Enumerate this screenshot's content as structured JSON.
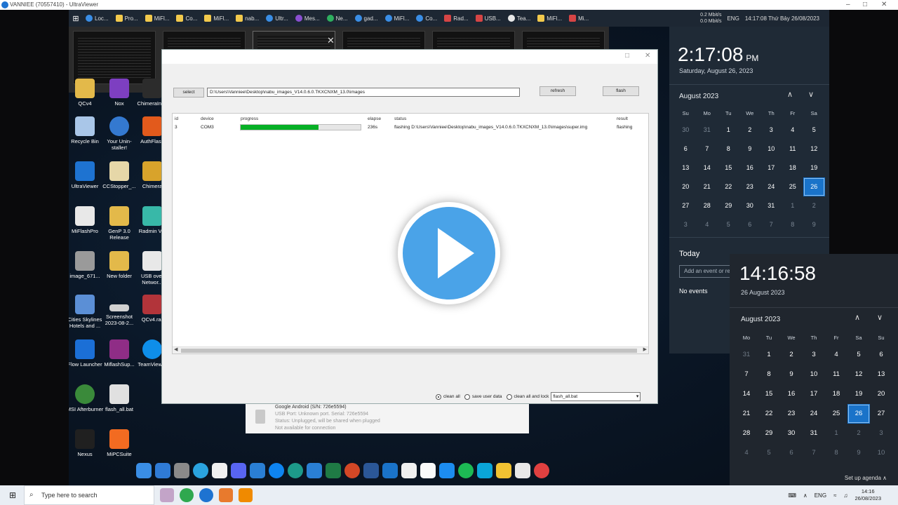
{
  "outer_window": {
    "title": "VANNIEE (70557410) - UltraViewer",
    "controls": [
      "–",
      "□",
      "✕"
    ]
  },
  "remote_taskbar": {
    "start_glyph": "⊞",
    "tabs": [
      "Loc...",
      "Pro...",
      "MiFl...",
      "Co...",
      "MiFl...",
      "nab...",
      "Ultr...",
      "Mes...",
      "Ne...",
      "gad...",
      "MiFl...",
      "Co...",
      "Rad...",
      "USB...",
      "Tea...",
      "MiFl...",
      "Mi..."
    ],
    "net_up": "0.2 Mbit/s",
    "net_down": "0.0 Mbit/s",
    "lang": "ENG",
    "datetime": "14:17:08 Thứ Bảy 26/08/2023"
  },
  "thumb_close": "✕",
  "desktop_icons": [
    {
      "label": "QCv4"
    },
    {
      "label": "Nox"
    },
    {
      "label": "ChimeraInt..."
    },
    {
      "label": "Recycle Bin"
    },
    {
      "label": "Your Unin-staller!"
    },
    {
      "label": "AuthFlash"
    },
    {
      "label": "UltraViewer"
    },
    {
      "label": "CCStopper_..."
    },
    {
      "label": "Chimera"
    },
    {
      "label": "MiFlashPro"
    },
    {
      "label": "GenP 3.0 Release"
    },
    {
      "label": "Radmin V..."
    },
    {
      "label": "image_671..."
    },
    {
      "label": "New folder"
    },
    {
      "label": "USB over Networ..."
    },
    {
      "label": "Cities Skylines Hotels and ..."
    },
    {
      "label": "Screenshot 2023-08-2..."
    },
    {
      "label": "QCv4.rar"
    },
    {
      "label": "Flow Launcher"
    },
    {
      "label": "MiflashSup..."
    },
    {
      "label": "TeamViewer"
    },
    {
      "label": "MSI Afterburner"
    },
    {
      "label": "flash_all.bat"
    },
    {
      "label": "Nexus"
    },
    {
      "label": "MiPCSuite"
    }
  ],
  "miflash": {
    "select_label": "select",
    "path": "D:\\Users\\Vanniee\\Desktop\\nabu_images_V14.0.6.0.TKXCNXM_13.0\\images",
    "refresh_label": "refresh",
    "flash_label": "flash",
    "columns": {
      "id": "id",
      "device": "device",
      "progress": "progress",
      "elapse": "elapse",
      "status": "status",
      "result": "result"
    },
    "row": {
      "id": "3",
      "device": "COM3",
      "progress": 0.65,
      "elapse": "236s",
      "status": "flashing D:\\Users\\Vanniee\\Desktop\\nabu_images_V14.0.6.0.TKXCNXM_13.0\\images\\super.img",
      "result": "flashing"
    },
    "options": {
      "clean_all": "clean all",
      "save_user_data": "save user data",
      "clean_all_lock": "clean all and lock",
      "script": "flash_all.bat"
    }
  },
  "device_notice": {
    "name": "Google Android (S/N: 726e5594)",
    "port": "USB Port: Unknown port. Serial: 726e5594",
    "status": "Status: Unplugged, will be shared when plugged",
    "availability": "Not available for connection"
  },
  "remote_calendar": {
    "time": "2:17:08",
    "ampm": "PM",
    "date": "Saturday, August 26, 2023",
    "month": "August 2023",
    "prev": "∧",
    "next": "∨",
    "dow": [
      "Su",
      "Mo",
      "Tu",
      "We",
      "Th",
      "Fr",
      "Sa"
    ],
    "today_label": "Today",
    "event_placeholder": "Add an event or reminder",
    "no_events": "No events"
  },
  "local_calendar": {
    "time": "14:16:58",
    "date": "26 August 2023",
    "month": "August 2023",
    "prev": "∧",
    "next": "∨",
    "dow": [
      "Mo",
      "Tu",
      "We",
      "Th",
      "Fr",
      "Sa",
      "Su"
    ],
    "agenda": "Set up agenda ∧"
  },
  "local_taskbar": {
    "search_placeholder": "Type here to search",
    "search_glyph": "⌕",
    "start_glyph": "⊞",
    "lang": "ENG",
    "time": "14:16",
    "date": "26/08/2023"
  },
  "colors": {
    "accent": "#1a73c9",
    "progress": "#06b025",
    "play": "#4aa3e8"
  }
}
